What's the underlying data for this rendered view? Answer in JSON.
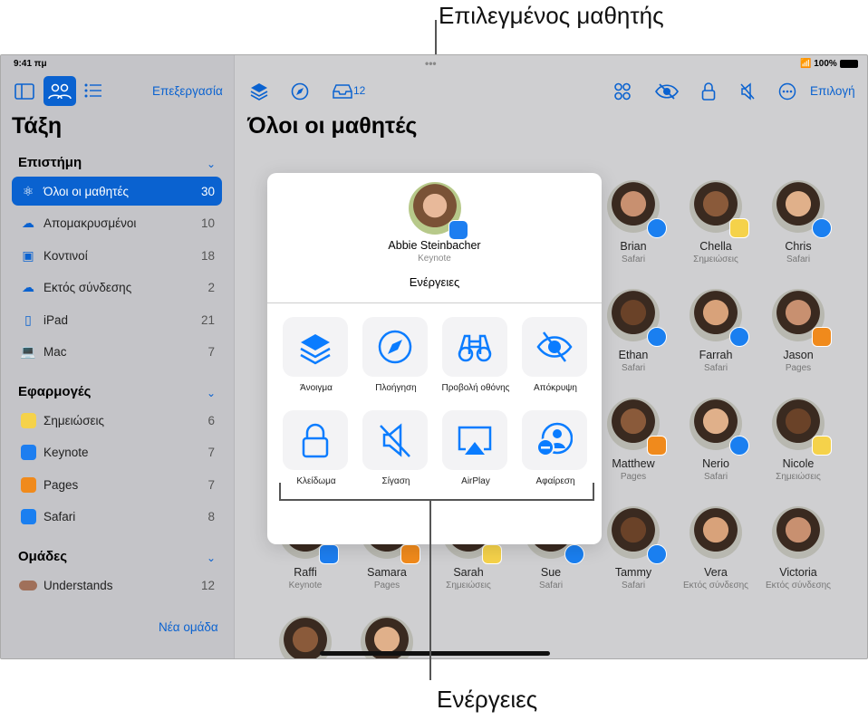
{
  "callouts": {
    "top": "Επιλεγμένος μαθητής",
    "bottom": "Ενέργειες"
  },
  "status": {
    "time": "9:41 πμ",
    "battery": "100%"
  },
  "sidebar": {
    "edit": "Επεξεργασία",
    "title": "Τάξη",
    "sections": [
      {
        "title": "Επιστήμη",
        "items": [
          {
            "label": "Όλοι οι μαθητές",
            "count": "30",
            "icon": "atom-icon",
            "selected": true
          },
          {
            "label": "Απομακρυσμένοι",
            "count": "10",
            "icon": "cloud-people-icon"
          },
          {
            "label": "Κοντινοί",
            "count": "18",
            "icon": "person-card-icon"
          },
          {
            "label": "Εκτός σύνδεσης",
            "count": "2",
            "icon": "cloud-offline-icon"
          },
          {
            "label": "iPad",
            "count": "21",
            "icon": "ipad-icon"
          },
          {
            "label": "Mac",
            "count": "7",
            "icon": "laptop-icon"
          }
        ]
      },
      {
        "title": "Εφαρμογές",
        "items": [
          {
            "label": "Σημειώσεις",
            "count": "6",
            "icon": "notes-app-icon"
          },
          {
            "label": "Keynote",
            "count": "7",
            "icon": "keynote-app-icon"
          },
          {
            "label": "Pages",
            "count": "7",
            "icon": "pages-app-icon"
          },
          {
            "label": "Safari",
            "count": "8",
            "icon": "safari-app-icon"
          }
        ]
      },
      {
        "title": "Ομάδες",
        "items": [
          {
            "label": "Understands",
            "count": "12",
            "icon": "group-avatars-icon"
          }
        ]
      }
    ],
    "new_group": "Νέα ομάδα"
  },
  "toolbar": {
    "inbox_count": "12",
    "select": "Επιλογή"
  },
  "main": {
    "title": "Όλοι οι μαθητές"
  },
  "students": [
    {
      "name": "Brian",
      "app": "Safari",
      "col": 4,
      "row": 0
    },
    {
      "name": "Chella",
      "app": "Σημειώσεις",
      "col": 5,
      "row": 0
    },
    {
      "name": "Chris",
      "app": "Safari",
      "col": 6,
      "row": 0
    },
    {
      "name": "Ethan",
      "app": "Safari",
      "col": 4,
      "row": 1
    },
    {
      "name": "Farrah",
      "app": "Safari",
      "col": 5,
      "row": 1
    },
    {
      "name": "Jason",
      "app": "Pages",
      "col": 6,
      "row": 1
    },
    {
      "name": "Matthew",
      "app": "Pages",
      "col": 4,
      "row": 2
    },
    {
      "name": "Nerio",
      "app": "Safari",
      "col": 5,
      "row": 2
    },
    {
      "name": "Nicole",
      "app": "Σημειώσεις",
      "col": 6,
      "row": 2
    },
    {
      "name": "Raffi",
      "app": "Keynote",
      "col": 0,
      "row": 3
    },
    {
      "name": "Samara",
      "app": "Pages",
      "col": 1,
      "row": 3
    },
    {
      "name": "Sarah",
      "app": "Σημειώσεις",
      "col": 2,
      "row": 3
    },
    {
      "name": "Sue",
      "app": "Safari",
      "col": 3,
      "row": 3
    },
    {
      "name": "Tammy",
      "app": "Safari",
      "col": 4,
      "row": 3
    },
    {
      "name": "Vera",
      "app": "Εκτός σύνδεσης",
      "col": 5,
      "row": 3
    },
    {
      "name": "Victoria",
      "app": "Εκτός σύνδεσης",
      "col": 6,
      "row": 3
    },
    {
      "name": "",
      "app": "",
      "col": 0,
      "row": 4
    },
    {
      "name": "",
      "app": "",
      "col": 1,
      "row": 4
    }
  ],
  "popover": {
    "student_name": "Abbie Steinbacher",
    "student_app": "Keynote",
    "heading": "Ενέργειες",
    "actions": [
      {
        "label": "Άνοιγμα",
        "icon": "layers-icon"
      },
      {
        "label": "Πλοήγηση",
        "icon": "compass-icon"
      },
      {
        "label": "Προβολή οθόνης",
        "icon": "binoculars-icon"
      },
      {
        "label": "Απόκρυψη",
        "icon": "eye-slash-icon"
      },
      {
        "label": "Κλείδωμα",
        "icon": "lock-icon"
      },
      {
        "label": "Σίγαση",
        "icon": "speaker-slash-icon"
      },
      {
        "label": "AirPlay",
        "icon": "airplay-icon"
      },
      {
        "label": "Αφαίρεση",
        "icon": "person-remove-icon"
      }
    ]
  },
  "colors": {
    "accent": "#0a62d0",
    "safari": "#1a7ff0",
    "pages": "#f08a1c",
    "keynote": "#1d7ef0",
    "notes": "#f5d24a"
  }
}
